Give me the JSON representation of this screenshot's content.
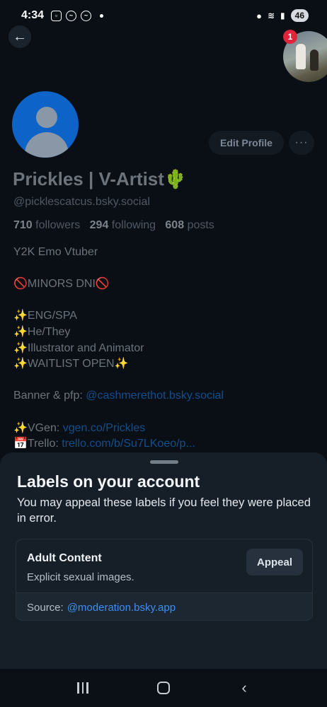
{
  "status_bar": {
    "time": "4:34",
    "battery": "46"
  },
  "header": {
    "back_icon": "arrow-left-icon",
    "notification_count": "1"
  },
  "profile": {
    "edit_label": "Edit Profile",
    "more_label": "···",
    "display_name": "Prickles | V-Artist🌵",
    "handle": "@picklescatcus.bsky.social",
    "stats": {
      "followers_count": "710",
      "followers_label": "followers",
      "following_count": "294",
      "following_label": "following",
      "posts_count": "608",
      "posts_label": "posts"
    },
    "bio": {
      "line1": "Y2K Emo Vtuber",
      "line2": "🚫MINORS DNI🚫",
      "line3": "✨ENG/SPA",
      "line4": "✨He/They",
      "line5": "✨Illustrator and Animator",
      "line6": "✨WAITLIST OPEN✨",
      "banner_prefix": "Banner & pfp: ",
      "banner_link": "@cashmerethot.bsky.social",
      "vgen_prefix": "✨VGen: ",
      "vgen_link": "vgen.co/Prickles",
      "trello_prefix": "📅Trello: ",
      "trello_link": "trello.com/b/Su7LKoeo/p..."
    }
  },
  "labels_sheet": {
    "title": "Labels on your account",
    "description": "You may appeal these labels if you feel they were placed in error.",
    "label": {
      "name": "Adult Content",
      "description": "Explicit sexual images.",
      "appeal_label": "Appeal",
      "source_prefix": "Source:",
      "source_link": "@moderation.bsky.app"
    }
  },
  "nav": {
    "recents_icon": "recent-apps-icon",
    "home_icon": "home-icon",
    "back_icon": "back-chevron-icon"
  }
}
